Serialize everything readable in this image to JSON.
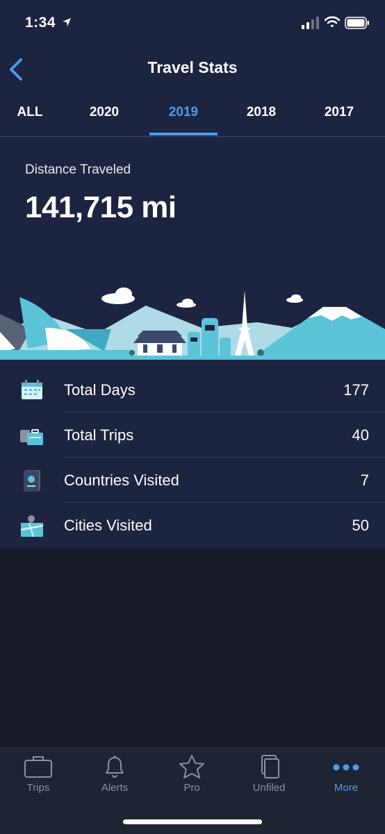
{
  "status_bar": {
    "time": "1:34"
  },
  "nav": {
    "title": "Travel Stats"
  },
  "year_tabs": [
    {
      "label": "ALL"
    },
    {
      "label": "2020"
    },
    {
      "label": "2019"
    },
    {
      "label": "2018"
    },
    {
      "label": "2017"
    }
  ],
  "selected_year_tab": "2019",
  "distance": {
    "label": "Distance Traveled",
    "value": "141,715 mi"
  },
  "stats": [
    {
      "label": "Total Days",
      "value": "177",
      "icon": "calendar-icon"
    },
    {
      "label": "Total Trips",
      "value": "40",
      "icon": "luggage-icon"
    },
    {
      "label": "Countries Visited",
      "value": "7",
      "icon": "passport-icon"
    },
    {
      "label": "Cities Visited",
      "value": "50",
      "icon": "map-pin-icon"
    }
  ],
  "tab_bar": [
    {
      "label": "Trips",
      "icon": "briefcase-icon"
    },
    {
      "label": "Alerts",
      "icon": "bell-icon"
    },
    {
      "label": "Pro",
      "icon": "star-icon"
    },
    {
      "label": "Unfiled",
      "icon": "documents-icon"
    },
    {
      "label": "More",
      "icon": "more-dots-icon"
    }
  ],
  "selected_bottom_tab": "More",
  "colors": {
    "background_top": "#1d2440",
    "background_bottom": "#171b26",
    "accent": "#4a9bf0",
    "illustration_teal": "#5bc4d8"
  }
}
